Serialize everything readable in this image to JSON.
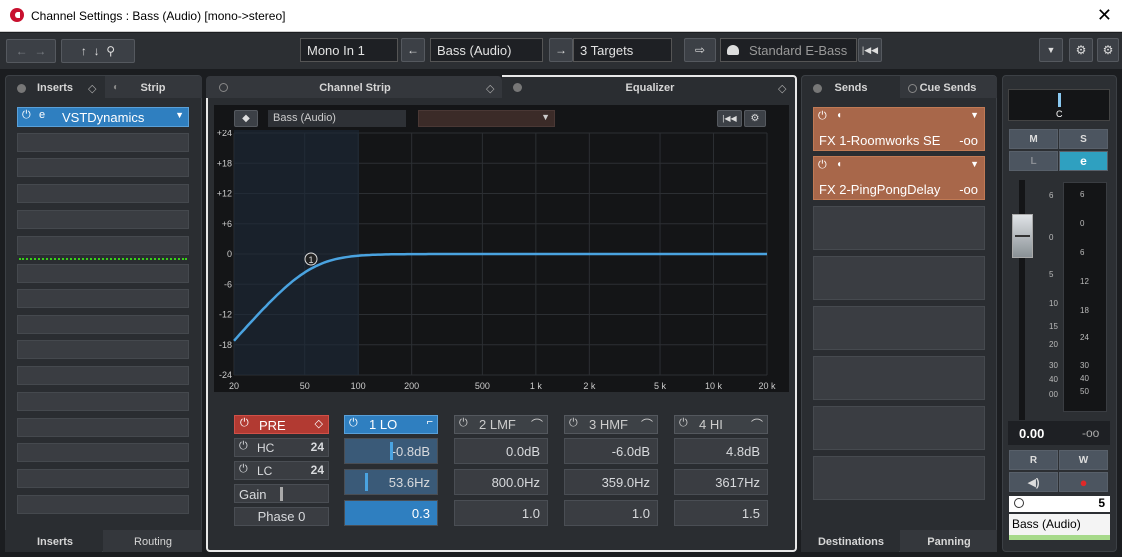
{
  "window": {
    "title": "Channel Settings : Bass (Audio) [mono->stereo]",
    "close": "✕"
  },
  "toolbar": {
    "input": "Mono In 1",
    "channel": "Bass (Audio)",
    "targets": "3 Targets",
    "preset": "Standard E-Bass"
  },
  "left_tabs": {
    "inserts": "Inserts",
    "strip": "Strip",
    "bottom_inserts": "Inserts",
    "bottom_routing": "Routing"
  },
  "inserts": [
    {
      "name": "VSTDynamics"
    }
  ],
  "center_tabs": {
    "channel_strip": "Channel Strip",
    "equalizer": "Equalizer"
  },
  "eq": {
    "channel": "Bass (Audio)",
    "y_labels": [
      "+24",
      "+18",
      "+12",
      "+6",
      "0",
      "-6",
      "-12",
      "-18",
      "-24"
    ],
    "x_labels": [
      "20",
      "50",
      "100",
      "200",
      "500",
      "1 k",
      "2 k",
      "5 k",
      "10 k",
      "20 k"
    ],
    "band_marker": "1",
    "pre": {
      "label": "PRE",
      "hc": "HC",
      "hc_val": "24",
      "lc": "LC",
      "lc_val": "24",
      "gain": "Gain",
      "phase": "Phase 0"
    },
    "bands": [
      {
        "name": "1 LO",
        "gain": "-0.8dB",
        "freq": "53.6Hz",
        "q": "0.3",
        "active": true
      },
      {
        "name": "2 LMF",
        "gain": "0.0dB",
        "freq": "800.0Hz",
        "q": "1.0",
        "active": false
      },
      {
        "name": "3 HMF",
        "gain": "-6.0dB",
        "freq": "359.0Hz",
        "q": "1.0",
        "active": false
      },
      {
        "name": "4 HI",
        "gain": "4.8dB",
        "freq": "3617Hz",
        "q": "1.5",
        "active": false
      }
    ]
  },
  "right_tabs": {
    "sends": "Sends",
    "cue_sends": "Cue Sends",
    "destinations": "Destinations",
    "panning": "Panning"
  },
  "sends": [
    {
      "name": "FX 1-Roomworks SE",
      "value": "-oo"
    },
    {
      "name": "FX 2-PingPongDelay",
      "value": "-oo"
    }
  ],
  "fader": {
    "pan": "C",
    "m": "M",
    "s": "S",
    "l": "L",
    "e": "e",
    "r": "R",
    "w": "W",
    "scale_left": [
      "6",
      "0",
      "5",
      "10",
      "15",
      "20",
      "30",
      "40",
      "00"
    ],
    "scale_right": [
      "6",
      "0",
      "6",
      "12",
      "18",
      "24",
      "30",
      "40",
      "50"
    ],
    "volume": "0.00",
    "peak": "-oo",
    "group": "5",
    "name": "Bass (Audio)"
  },
  "colors": {
    "accent": "#2f7fc0",
    "send": "#a8674a",
    "eq_curve": "#4aa3e0"
  }
}
